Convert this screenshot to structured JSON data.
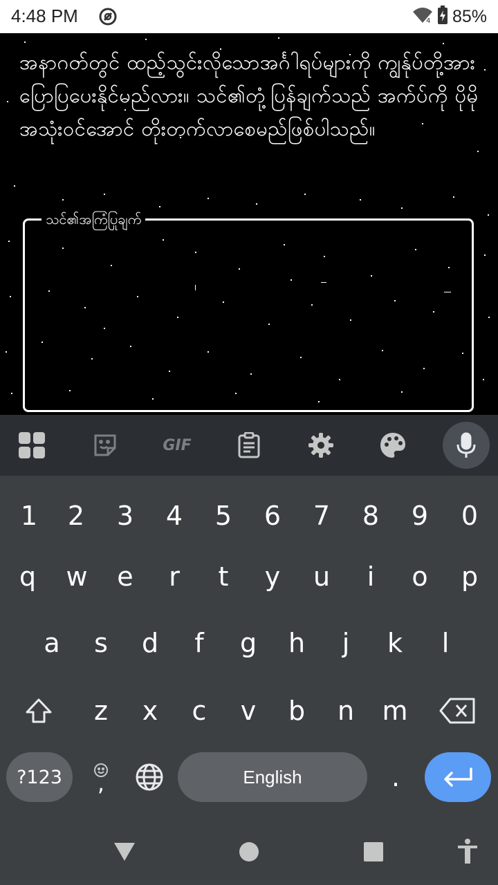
{
  "status_bar": {
    "time": "4:48 PM",
    "battery": "85%",
    "icons": [
      "notification-icon",
      "wifi-icon",
      "battery-charging-icon"
    ]
  },
  "main": {
    "description": "အနာဂတ်တွင် ထည့်သွင်းလိုသောအင်္ဂါရပ်များကို ကျွန်ုပ်တို့အား ပြောပြပေးနိုင်မည်လား။ သင်၏တုံ့ပြန်ချက်သည် အက်ပ်ကို ပိုမိုအသုံးဝင်အောင် တိုးတက်လာစေမည်ဖြစ်ပါသည်။",
    "feedback_label": "သင်၏အကြံပြုချက်",
    "feedback_value": ""
  },
  "keyboard": {
    "toolbar_icons": [
      "apps-grid-icon",
      "sticker-icon",
      "gif-icon",
      "clipboard-icon",
      "settings-gear-icon",
      "palette-icon",
      "mic-icon"
    ],
    "gif_label": "GIF",
    "number_row": [
      "1",
      "2",
      "3",
      "4",
      "5",
      "6",
      "7",
      "8",
      "9",
      "0"
    ],
    "row1": [
      "q",
      "w",
      "e",
      "r",
      "t",
      "y",
      "u",
      "i",
      "o",
      "p"
    ],
    "row2": [
      "a",
      "s",
      "d",
      "f",
      "g",
      "h",
      "j",
      "k",
      "l"
    ],
    "row3": [
      "z",
      "x",
      "c",
      "v",
      "b",
      "n",
      "m"
    ],
    "symbols_label": "?123",
    "comma_label": ",",
    "space_label": "English",
    "period_label": "."
  },
  "colors": {
    "keyboard_bg": "#3c4043",
    "toolbar_bg": "#2b2f33",
    "enter_key": "#5b9cf5",
    "status_bar_bg": "#ffffff"
  }
}
